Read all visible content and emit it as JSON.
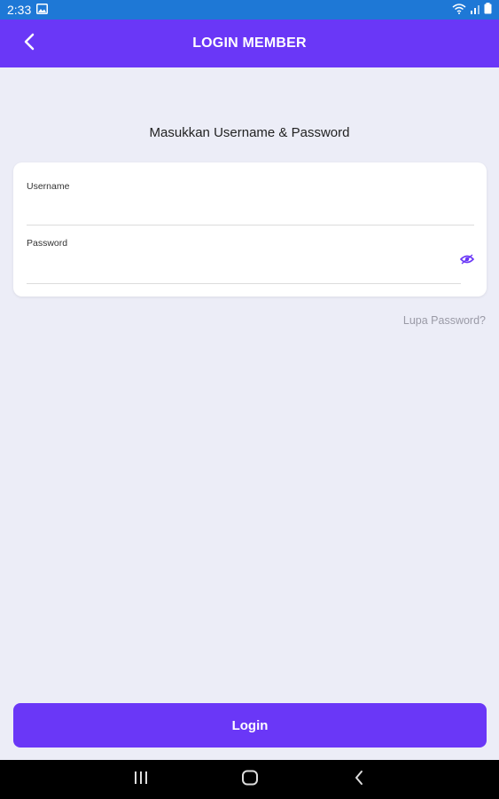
{
  "status_bar": {
    "time": "2:33",
    "icons": [
      "image-icon",
      "wifi-icon",
      "signal-icon",
      "battery-icon"
    ]
  },
  "app_bar": {
    "title": "LOGIN MEMBER",
    "back_icon": "chevron-left-icon"
  },
  "heading": "Masukkan Username & Password",
  "form": {
    "username_label": "Username",
    "username_value": "",
    "password_label": "Password",
    "password_value": "",
    "eye_icon": "eye-icon"
  },
  "forgot_password": "Lupa Password?",
  "login_button": "Login",
  "nav_bar": {
    "icons": [
      "recent-apps-icon",
      "home-icon",
      "back-icon"
    ]
  },
  "colors": {
    "status_bar": "#1e78d6",
    "primary": "#6a37f7",
    "background": "#ecedf7",
    "card": "#ffffff",
    "muted_text": "#9a9aa6"
  }
}
